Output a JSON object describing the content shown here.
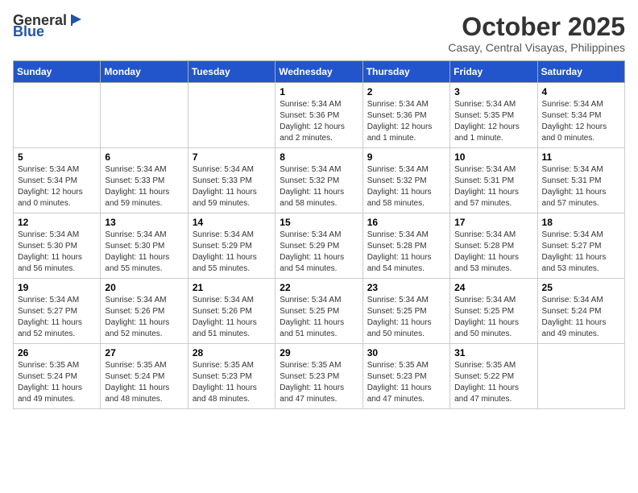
{
  "logo": {
    "general": "General",
    "blue": "Blue"
  },
  "title": "October 2025",
  "location": "Casay, Central Visayas, Philippines",
  "headers": [
    "Sunday",
    "Monday",
    "Tuesday",
    "Wednesday",
    "Thursday",
    "Friday",
    "Saturday"
  ],
  "weeks": [
    [
      {
        "day": "",
        "info": ""
      },
      {
        "day": "",
        "info": ""
      },
      {
        "day": "",
        "info": ""
      },
      {
        "day": "1",
        "info": "Sunrise: 5:34 AM\nSunset: 5:36 PM\nDaylight: 12 hours\nand 2 minutes."
      },
      {
        "day": "2",
        "info": "Sunrise: 5:34 AM\nSunset: 5:36 PM\nDaylight: 12 hours\nand 1 minute."
      },
      {
        "day": "3",
        "info": "Sunrise: 5:34 AM\nSunset: 5:35 PM\nDaylight: 12 hours\nand 1 minute."
      },
      {
        "day": "4",
        "info": "Sunrise: 5:34 AM\nSunset: 5:34 PM\nDaylight: 12 hours\nand 0 minutes."
      }
    ],
    [
      {
        "day": "5",
        "info": "Sunrise: 5:34 AM\nSunset: 5:34 PM\nDaylight: 12 hours\nand 0 minutes."
      },
      {
        "day": "6",
        "info": "Sunrise: 5:34 AM\nSunset: 5:33 PM\nDaylight: 11 hours\nand 59 minutes."
      },
      {
        "day": "7",
        "info": "Sunrise: 5:34 AM\nSunset: 5:33 PM\nDaylight: 11 hours\nand 59 minutes."
      },
      {
        "day": "8",
        "info": "Sunrise: 5:34 AM\nSunset: 5:32 PM\nDaylight: 11 hours\nand 58 minutes."
      },
      {
        "day": "9",
        "info": "Sunrise: 5:34 AM\nSunset: 5:32 PM\nDaylight: 11 hours\nand 58 minutes."
      },
      {
        "day": "10",
        "info": "Sunrise: 5:34 AM\nSunset: 5:31 PM\nDaylight: 11 hours\nand 57 minutes."
      },
      {
        "day": "11",
        "info": "Sunrise: 5:34 AM\nSunset: 5:31 PM\nDaylight: 11 hours\nand 57 minutes."
      }
    ],
    [
      {
        "day": "12",
        "info": "Sunrise: 5:34 AM\nSunset: 5:30 PM\nDaylight: 11 hours\nand 56 minutes."
      },
      {
        "day": "13",
        "info": "Sunrise: 5:34 AM\nSunset: 5:30 PM\nDaylight: 11 hours\nand 55 minutes."
      },
      {
        "day": "14",
        "info": "Sunrise: 5:34 AM\nSunset: 5:29 PM\nDaylight: 11 hours\nand 55 minutes."
      },
      {
        "day": "15",
        "info": "Sunrise: 5:34 AM\nSunset: 5:29 PM\nDaylight: 11 hours\nand 54 minutes."
      },
      {
        "day": "16",
        "info": "Sunrise: 5:34 AM\nSunset: 5:28 PM\nDaylight: 11 hours\nand 54 minutes."
      },
      {
        "day": "17",
        "info": "Sunrise: 5:34 AM\nSunset: 5:28 PM\nDaylight: 11 hours\nand 53 minutes."
      },
      {
        "day": "18",
        "info": "Sunrise: 5:34 AM\nSunset: 5:27 PM\nDaylight: 11 hours\nand 53 minutes."
      }
    ],
    [
      {
        "day": "19",
        "info": "Sunrise: 5:34 AM\nSunset: 5:27 PM\nDaylight: 11 hours\nand 52 minutes."
      },
      {
        "day": "20",
        "info": "Sunrise: 5:34 AM\nSunset: 5:26 PM\nDaylight: 11 hours\nand 52 minutes."
      },
      {
        "day": "21",
        "info": "Sunrise: 5:34 AM\nSunset: 5:26 PM\nDaylight: 11 hours\nand 51 minutes."
      },
      {
        "day": "22",
        "info": "Sunrise: 5:34 AM\nSunset: 5:25 PM\nDaylight: 11 hours\nand 51 minutes."
      },
      {
        "day": "23",
        "info": "Sunrise: 5:34 AM\nSunset: 5:25 PM\nDaylight: 11 hours\nand 50 minutes."
      },
      {
        "day": "24",
        "info": "Sunrise: 5:34 AM\nSunset: 5:25 PM\nDaylight: 11 hours\nand 50 minutes."
      },
      {
        "day": "25",
        "info": "Sunrise: 5:34 AM\nSunset: 5:24 PM\nDaylight: 11 hours\nand 49 minutes."
      }
    ],
    [
      {
        "day": "26",
        "info": "Sunrise: 5:35 AM\nSunset: 5:24 PM\nDaylight: 11 hours\nand 49 minutes."
      },
      {
        "day": "27",
        "info": "Sunrise: 5:35 AM\nSunset: 5:24 PM\nDaylight: 11 hours\nand 48 minutes."
      },
      {
        "day": "28",
        "info": "Sunrise: 5:35 AM\nSunset: 5:23 PM\nDaylight: 11 hours\nand 48 minutes."
      },
      {
        "day": "29",
        "info": "Sunrise: 5:35 AM\nSunset: 5:23 PM\nDaylight: 11 hours\nand 47 minutes."
      },
      {
        "day": "30",
        "info": "Sunrise: 5:35 AM\nSunset: 5:23 PM\nDaylight: 11 hours\nand 47 minutes."
      },
      {
        "day": "31",
        "info": "Sunrise: 5:35 AM\nSunset: 5:22 PM\nDaylight: 11 hours\nand 47 minutes."
      },
      {
        "day": "",
        "info": ""
      }
    ]
  ]
}
